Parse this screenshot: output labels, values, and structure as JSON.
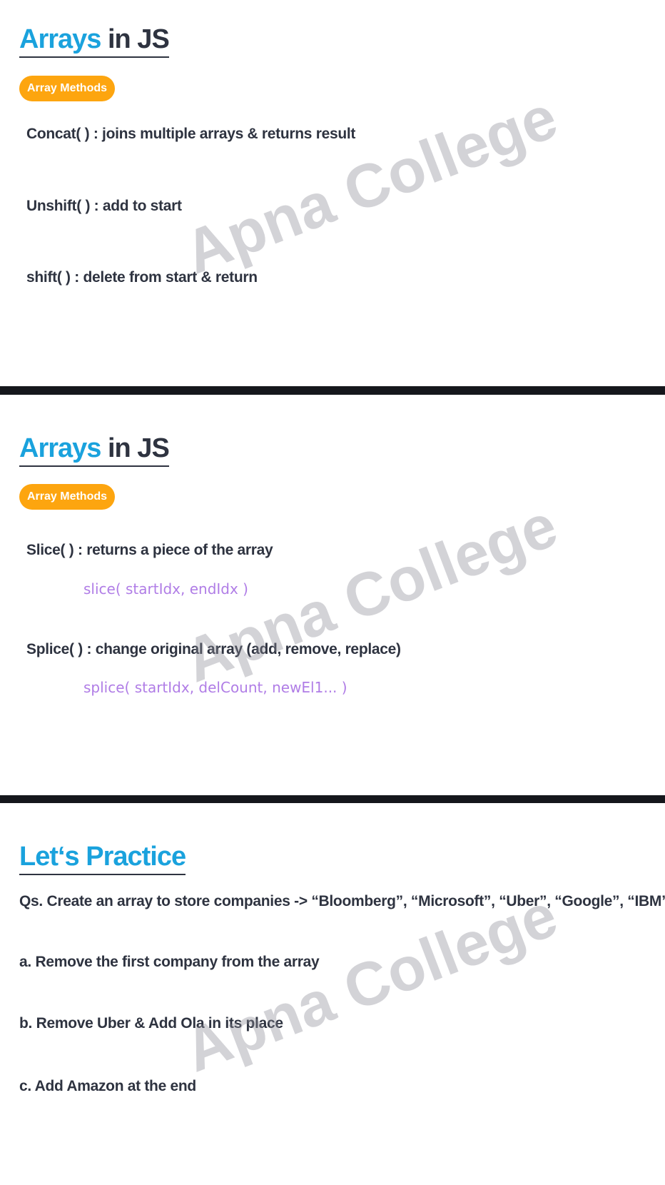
{
  "slides": [
    {
      "title_accent": "Arrays",
      "title_rest": " in JS",
      "pill": "Array Methods",
      "lines": [
        "Concat( ) : joins multiple arrays & returns result",
        "Unshift( ) : add to start",
        "shift( ) : delete from start & return"
      ],
      "watermark": "Apna College"
    },
    {
      "title_accent": "Arrays",
      "title_rest": " in JS",
      "pill": "Array Methods",
      "lines": [
        "Slice( ) : returns a piece of the array",
        "Splice( ) : change original array (add, remove, replace)"
      ],
      "syntax": [
        "slice( startIdx, endIdx )",
        "splice( startIdx, delCount, newEl1... )"
      ],
      "watermark": "Apna College"
    },
    {
      "title": "Let‘s Practice",
      "question": "Qs. Create an array to store companies -> “Bloomberg”, “Microsoft”, “Uber”, “Google”, “IBM”, “Netflix”",
      "tasks": [
        "a. Remove the first company from the array",
        "b. Remove Uber & Add Ola in its place",
        "c. Add Amazon at the end"
      ],
      "watermark": "Apna College"
    }
  ],
  "colors": {
    "accent_blue": "#1aa2dd",
    "pill_orange": "#fda50f",
    "syntax_purple": "#b07de6",
    "text_dark": "#2e3340",
    "divider": "#15171c"
  }
}
